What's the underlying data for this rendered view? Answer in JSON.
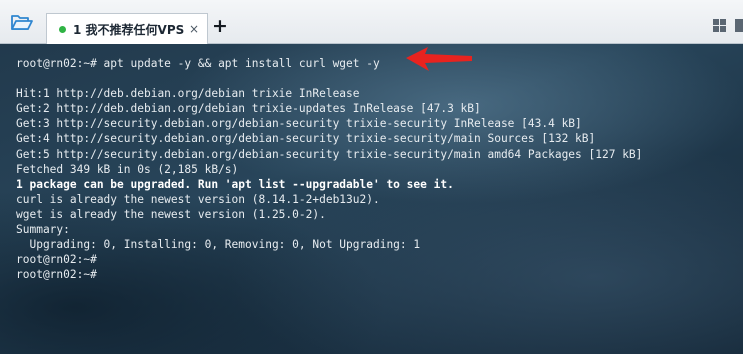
{
  "tab": {
    "label": "1 我不推荐任何VPS",
    "close": "×"
  },
  "tabbar": {
    "add": "+"
  },
  "terminal": {
    "lines": [
      {
        "text": "root@rn02:~# apt update -y && apt install curl wget -y"
      },
      {
        "text": ""
      },
      {
        "text": "Hit:1 http://deb.debian.org/debian trixie InRelease"
      },
      {
        "text": "Get:2 http://deb.debian.org/debian trixie-updates InRelease [47.3 kB]"
      },
      {
        "text": "Get:3 http://security.debian.org/debian-security trixie-security InRelease [43.4 kB]"
      },
      {
        "text": "Get:4 http://security.debian.org/debian-security trixie-security/main Sources [132 kB]"
      },
      {
        "text": "Get:5 http://security.debian.org/debian-security trixie-security/main amd64 Packages [127 kB]"
      },
      {
        "text": "Fetched 349 kB in 0s (2,185 kB/s)"
      },
      {
        "text": "1 package can be upgraded. Run 'apt list --upgradable' to see it.",
        "bold": true
      },
      {
        "text": "curl is already the newest version (8.14.1-2+deb13u2)."
      },
      {
        "text": "wget is already the newest version (1.25.0-2)."
      },
      {
        "text": "Summary:"
      },
      {
        "text": "  Upgrading: 0, Installing: 0, Removing: 0, Not Upgrading: 1"
      },
      {
        "text": "root@rn02:~#"
      },
      {
        "text": "root@rn02:~#"
      }
    ]
  },
  "colors": {
    "accent_arrow": "#e8231f",
    "tab_status": "#2fb344",
    "folder": "#2f86d0"
  },
  "icons": [
    "folder-icon",
    "status-dot-icon",
    "close-icon",
    "plus-icon",
    "grid-icon",
    "more-icon",
    "arrow-annotation-icon"
  ]
}
